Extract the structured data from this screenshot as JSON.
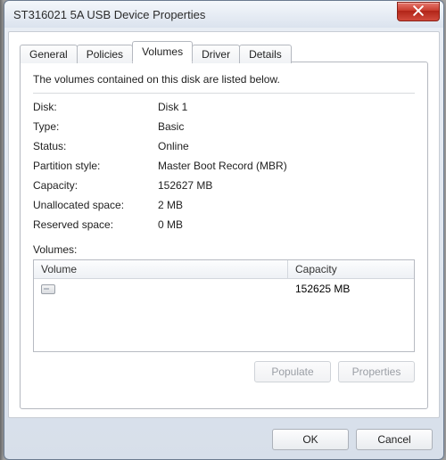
{
  "window": {
    "title": "ST316021 5A USB Device Properties"
  },
  "tabs": {
    "general": "General",
    "policies": "Policies",
    "volumes": "Volumes",
    "driver": "Driver",
    "details": "Details",
    "active": "volumes"
  },
  "panel": {
    "intro": "The volumes contained on this disk are listed below.",
    "labels": {
      "disk": "Disk:",
      "type": "Type:",
      "status": "Status:",
      "partition_style": "Partition style:",
      "capacity": "Capacity:",
      "unallocated": "Unallocated space:",
      "reserved": "Reserved space:",
      "volumes": "Volumes:"
    },
    "values": {
      "disk": "Disk 1",
      "type": "Basic",
      "status": "Online",
      "partition_style": "Master Boot Record (MBR)",
      "capacity": "152627 MB",
      "unallocated": "2 MB",
      "reserved": "0 MB"
    },
    "list": {
      "headers": {
        "volume": "Volume",
        "capacity": "Capacity"
      },
      "row0": {
        "volume": "",
        "capacity": "152625 MB"
      }
    },
    "buttons": {
      "populate": "Populate",
      "properties": "Properties"
    }
  },
  "dialog_buttons": {
    "ok": "OK",
    "cancel": "Cancel"
  }
}
